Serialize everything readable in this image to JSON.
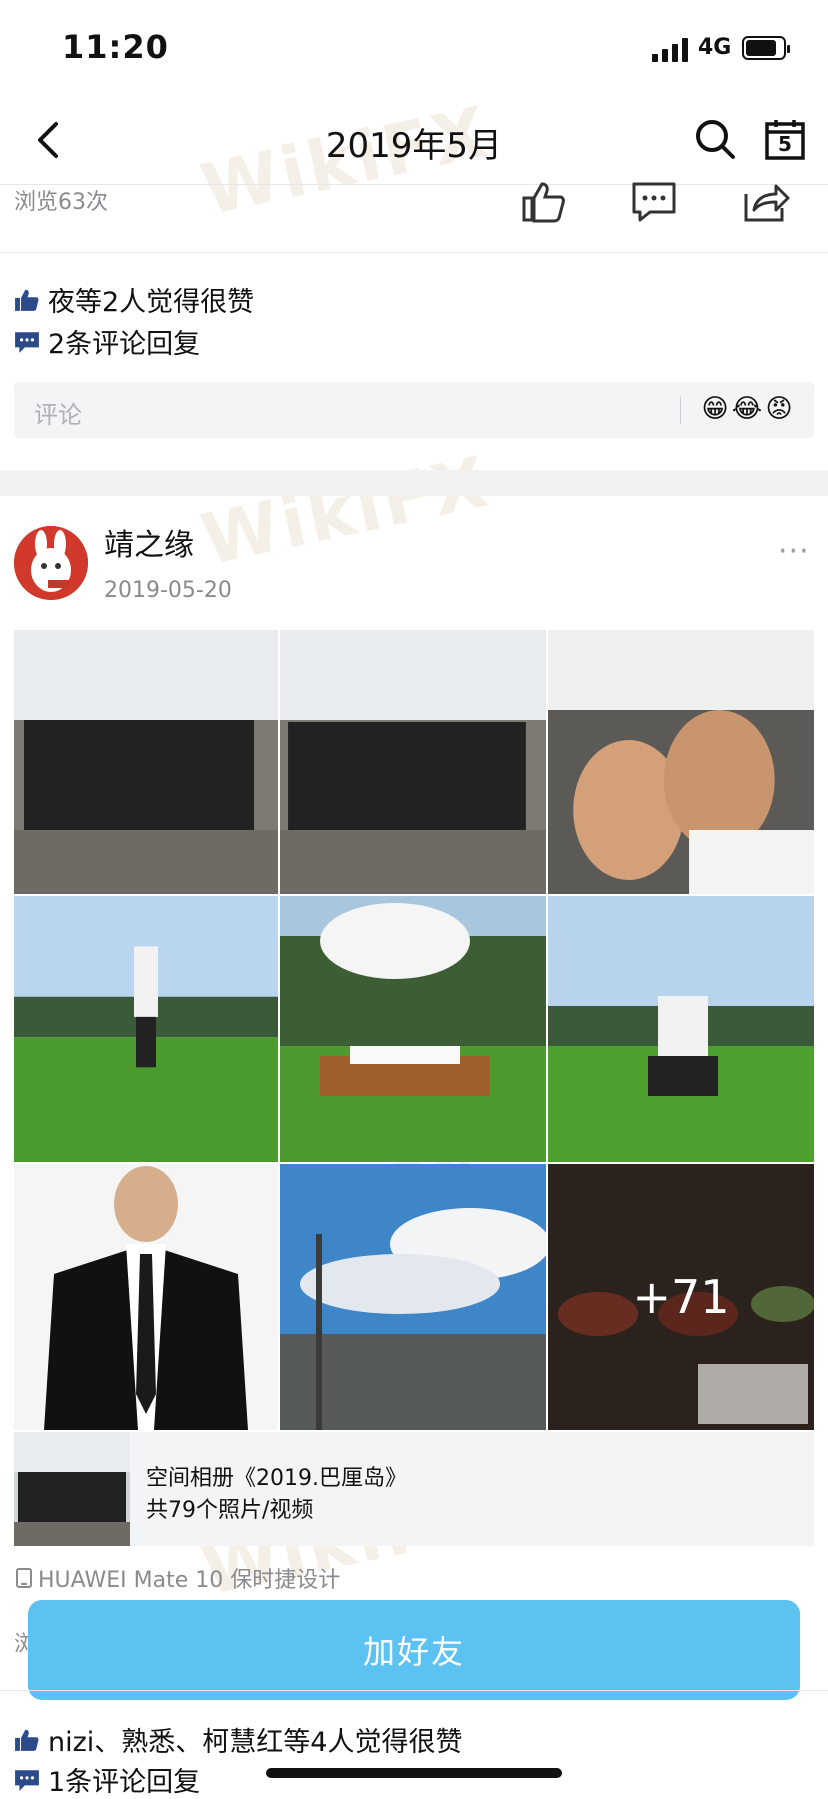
{
  "status_bar": {
    "time": "11:20",
    "network": "4G"
  },
  "nav": {
    "title": "2019年5月",
    "calendar_day": "5"
  },
  "post1": {
    "views": "浏览63次",
    "likes": "夜等2人觉得很赞",
    "comments": "2条评论回复",
    "comment_placeholder": "评论",
    "emojis": [
      "😁",
      "😂",
      "😡"
    ]
  },
  "post2": {
    "username": "靖之缘",
    "date": "2019-05-20",
    "more": "···",
    "extra_photos": "+71",
    "album": {
      "title": "空间相册《2019.巴厘岛》",
      "count": "共79个照片/视频"
    },
    "device": "HUAWEI Mate 10 保时捷设计",
    "views_partial": "浏",
    "likes": "nizi、熟悉、柯慧红等4人觉得很赞",
    "comments": "1条评论回复"
  },
  "add_friend_button": "加好友",
  "watermark": "WikiFX",
  "colors": {
    "button": "#5bc2f2",
    "secondary_text": "#8a8a8f",
    "icon_blue": "#2a4a8a"
  }
}
